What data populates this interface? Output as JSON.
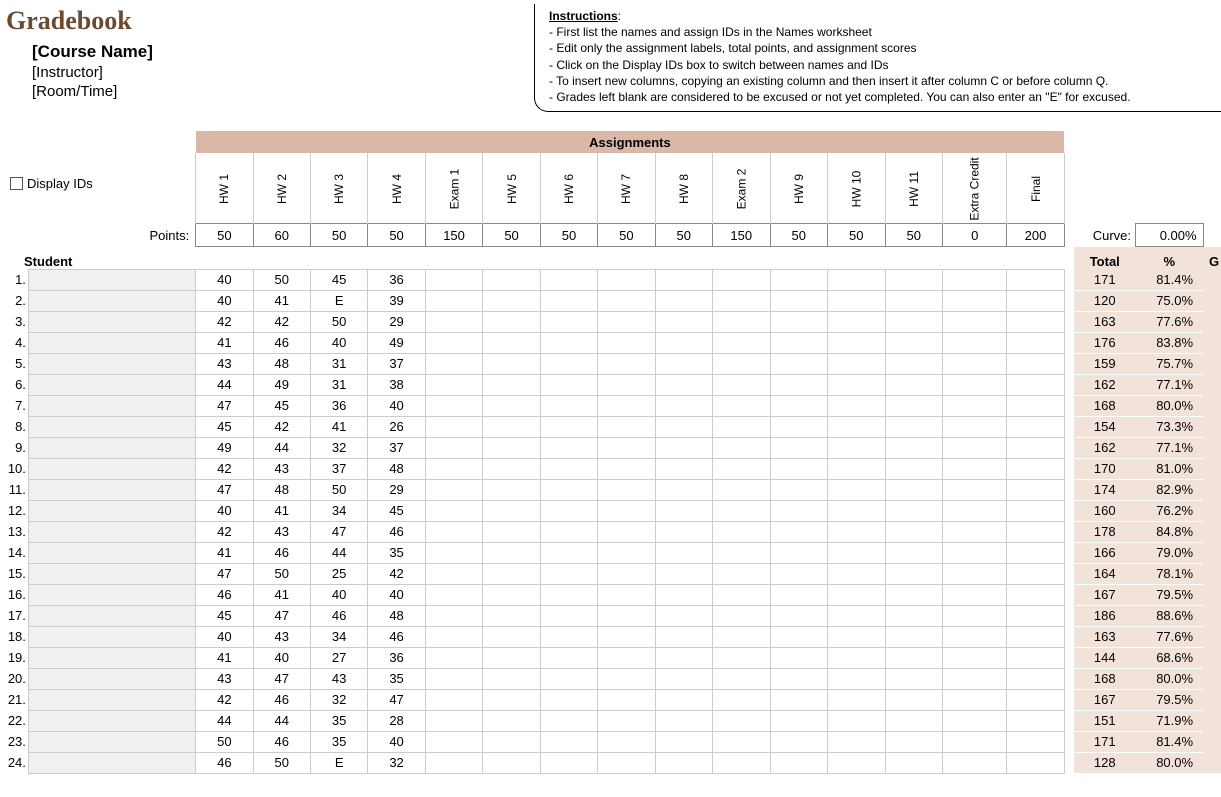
{
  "title": "Gradebook",
  "course_name": "[Course Name]",
  "instructor": "[Instructor]",
  "room_time": "[Room/Time]",
  "instructions": {
    "heading": "Instructions",
    "lines": [
      "- First list the names and assign IDs in the Names worksheet",
      "- Edit only the assignment labels, total points, and assignment scores",
      "- Click on the Display IDs box to switch between names and IDs",
      "- To insert new columns, copying an existing column and then insert it after column C or before column Q.",
      "- Grades left blank are considered to be excused or not yet completed. You can also enter an \"E\" for excused."
    ]
  },
  "display_ids_label": "Display IDs",
  "assignments_header": "Assignments",
  "points_label": "Points:",
  "curve_label": "Curve:",
  "curve_value": "0.00%",
  "student_header": "Student",
  "total_header": "Total",
  "pct_header": "%",
  "grade_header": "G",
  "assignments": [
    {
      "name": "HW 1",
      "points": "50"
    },
    {
      "name": "HW 2",
      "points": "60"
    },
    {
      "name": "HW 3",
      "points": "50"
    },
    {
      "name": "HW 4",
      "points": "50"
    },
    {
      "name": "Exam 1",
      "points": "150"
    },
    {
      "name": "HW 5",
      "points": "50"
    },
    {
      "name": "HW 6",
      "points": "50"
    },
    {
      "name": "HW 7",
      "points": "50"
    },
    {
      "name": "HW 8",
      "points": "50"
    },
    {
      "name": "Exam 2",
      "points": "150"
    },
    {
      "name": "HW 9",
      "points": "50"
    },
    {
      "name": "HW 10",
      "points": "50"
    },
    {
      "name": "HW 11",
      "points": "50"
    },
    {
      "name": "Extra Credit",
      "points": "0"
    },
    {
      "name": "Final",
      "points": "200"
    }
  ],
  "rows": [
    {
      "n": "1.",
      "s": [
        "40",
        "50",
        "45",
        "36",
        "",
        "",
        "",
        "",
        "",
        "",
        "",
        "",
        "",
        "",
        ""
      ],
      "t": "171",
      "p": "81.4%"
    },
    {
      "n": "2.",
      "s": [
        "40",
        "41",
        "E",
        "39",
        "",
        "",
        "",
        "",
        "",
        "",
        "",
        "",
        "",
        "",
        ""
      ],
      "t": "120",
      "p": "75.0%"
    },
    {
      "n": "3.",
      "s": [
        "42",
        "42",
        "50",
        "29",
        "",
        "",
        "",
        "",
        "",
        "",
        "",
        "",
        "",
        "",
        ""
      ],
      "t": "163",
      "p": "77.6%"
    },
    {
      "n": "4.",
      "s": [
        "41",
        "46",
        "40",
        "49",
        "",
        "",
        "",
        "",
        "",
        "",
        "",
        "",
        "",
        "",
        ""
      ],
      "t": "176",
      "p": "83.8%"
    },
    {
      "n": "5.",
      "s": [
        "43",
        "48",
        "31",
        "37",
        "",
        "",
        "",
        "",
        "",
        "",
        "",
        "",
        "",
        "",
        ""
      ],
      "t": "159",
      "p": "75.7%"
    },
    {
      "n": "6.",
      "s": [
        "44",
        "49",
        "31",
        "38",
        "",
        "",
        "",
        "",
        "",
        "",
        "",
        "",
        "",
        "",
        ""
      ],
      "t": "162",
      "p": "77.1%"
    },
    {
      "n": "7.",
      "s": [
        "47",
        "45",
        "36",
        "40",
        "",
        "",
        "",
        "",
        "",
        "",
        "",
        "",
        "",
        "",
        ""
      ],
      "t": "168",
      "p": "80.0%"
    },
    {
      "n": "8.",
      "s": [
        "45",
        "42",
        "41",
        "26",
        "",
        "",
        "",
        "",
        "",
        "",
        "",
        "",
        "",
        "",
        ""
      ],
      "t": "154",
      "p": "73.3%"
    },
    {
      "n": "9.",
      "s": [
        "49",
        "44",
        "32",
        "37",
        "",
        "",
        "",
        "",
        "",
        "",
        "",
        "",
        "",
        "",
        ""
      ],
      "t": "162",
      "p": "77.1%"
    },
    {
      "n": "10.",
      "s": [
        "42",
        "43",
        "37",
        "48",
        "",
        "",
        "",
        "",
        "",
        "",
        "",
        "",
        "",
        "",
        ""
      ],
      "t": "170",
      "p": "81.0%"
    },
    {
      "n": "11.",
      "s": [
        "47",
        "48",
        "50",
        "29",
        "",
        "",
        "",
        "",
        "",
        "",
        "",
        "",
        "",
        "",
        ""
      ],
      "t": "174",
      "p": "82.9%"
    },
    {
      "n": "12.",
      "s": [
        "40",
        "41",
        "34",
        "45",
        "",
        "",
        "",
        "",
        "",
        "",
        "",
        "",
        "",
        "",
        ""
      ],
      "t": "160",
      "p": "76.2%"
    },
    {
      "n": "13.",
      "s": [
        "42",
        "43",
        "47",
        "46",
        "",
        "",
        "",
        "",
        "",
        "",
        "",
        "",
        "",
        "",
        ""
      ],
      "t": "178",
      "p": "84.8%"
    },
    {
      "n": "14.",
      "s": [
        "41",
        "46",
        "44",
        "35",
        "",
        "",
        "",
        "",
        "",
        "",
        "",
        "",
        "",
        "",
        ""
      ],
      "t": "166",
      "p": "79.0%"
    },
    {
      "n": "15.",
      "s": [
        "47",
        "50",
        "25",
        "42",
        "",
        "",
        "",
        "",
        "",
        "",
        "",
        "",
        "",
        "",
        ""
      ],
      "t": "164",
      "p": "78.1%"
    },
    {
      "n": "16.",
      "s": [
        "46",
        "41",
        "40",
        "40",
        "",
        "",
        "",
        "",
        "",
        "",
        "",
        "",
        "",
        "",
        ""
      ],
      "t": "167",
      "p": "79.5%"
    },
    {
      "n": "17.",
      "s": [
        "45",
        "47",
        "46",
        "48",
        "",
        "",
        "",
        "",
        "",
        "",
        "",
        "",
        "",
        "",
        ""
      ],
      "t": "186",
      "p": "88.6%"
    },
    {
      "n": "18.",
      "s": [
        "40",
        "43",
        "34",
        "46",
        "",
        "",
        "",
        "",
        "",
        "",
        "",
        "",
        "",
        "",
        ""
      ],
      "t": "163",
      "p": "77.6%"
    },
    {
      "n": "19.",
      "s": [
        "41",
        "40",
        "27",
        "36",
        "",
        "",
        "",
        "",
        "",
        "",
        "",
        "",
        "",
        "",
        ""
      ],
      "t": "144",
      "p": "68.6%"
    },
    {
      "n": "20.",
      "s": [
        "43",
        "47",
        "43",
        "35",
        "",
        "",
        "",
        "",
        "",
        "",
        "",
        "",
        "",
        "",
        ""
      ],
      "t": "168",
      "p": "80.0%"
    },
    {
      "n": "21.",
      "s": [
        "42",
        "46",
        "32",
        "47",
        "",
        "",
        "",
        "",
        "",
        "",
        "",
        "",
        "",
        "",
        ""
      ],
      "t": "167",
      "p": "79.5%"
    },
    {
      "n": "22.",
      "s": [
        "44",
        "44",
        "35",
        "28",
        "",
        "",
        "",
        "",
        "",
        "",
        "",
        "",
        "",
        "",
        ""
      ],
      "t": "151",
      "p": "71.9%"
    },
    {
      "n": "23.",
      "s": [
        "50",
        "46",
        "35",
        "40",
        "",
        "",
        "",
        "",
        "",
        "",
        "",
        "",
        "",
        "",
        ""
      ],
      "t": "171",
      "p": "81.4%"
    },
    {
      "n": "24.",
      "s": [
        "46",
        "50",
        "E",
        "32",
        "",
        "",
        "",
        "",
        "",
        "",
        "",
        "",
        "",
        "",
        ""
      ],
      "t": "128",
      "p": "80.0%"
    }
  ]
}
